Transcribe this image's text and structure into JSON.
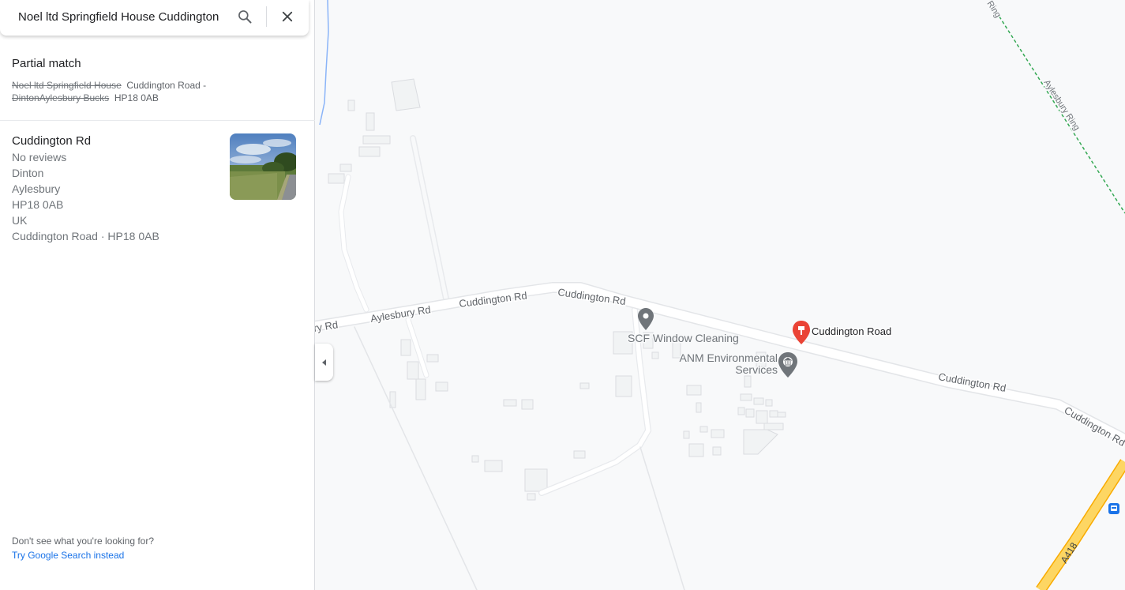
{
  "search": {
    "value": "Noel ltd Springfield House Cuddington",
    "search_icon": "search-icon",
    "close_icon": "close-icon"
  },
  "partial_match": {
    "title": "Partial match",
    "strike_1": "Noel ltd Springfield House",
    "part_1": "Cuddington Road -",
    "strike_2": "DintonAylesbury Bucks",
    "part_2": "HP18 0AB"
  },
  "result": {
    "title": "Cuddington Rd",
    "lines": [
      "No reviews",
      "Dinton",
      "Aylesbury",
      "HP18 0AB",
      "UK",
      "Cuddington Road · HP18 0AB"
    ]
  },
  "footer": {
    "question": "Don't see what you're looking for?",
    "link": "Try Google Search instead"
  },
  "map": {
    "road_labels": {
      "aylesbury_rd_a": "ry Rd",
      "aylesbury_rd_b": "Aylesbury Rd",
      "cuddington_rd_1": "Cuddington Rd",
      "cuddington_rd_2": "Cuddington Rd",
      "cuddington_rd_3": "Cuddington Rd",
      "cuddington_rd_4": "Cuddington Rd"
    },
    "ring_labels": {
      "aylesbury_ring": "Aylesbury Ring",
      "ring_top": "Ring"
    },
    "a418": "A418",
    "places": {
      "pin": "Cuddington Road",
      "scf": "SCF Window Cleaning",
      "anm_line1": "ANM Environmental",
      "anm_line2": "Services"
    },
    "colors": {
      "background": "#f8f9fa",
      "road": "#ffffff",
      "building": "#f1f3f4",
      "major_road": "#fdd663",
      "pin": "#ea4335",
      "poi": "#70757a",
      "ring": "#34a853",
      "water": "#8ab4f8"
    }
  }
}
